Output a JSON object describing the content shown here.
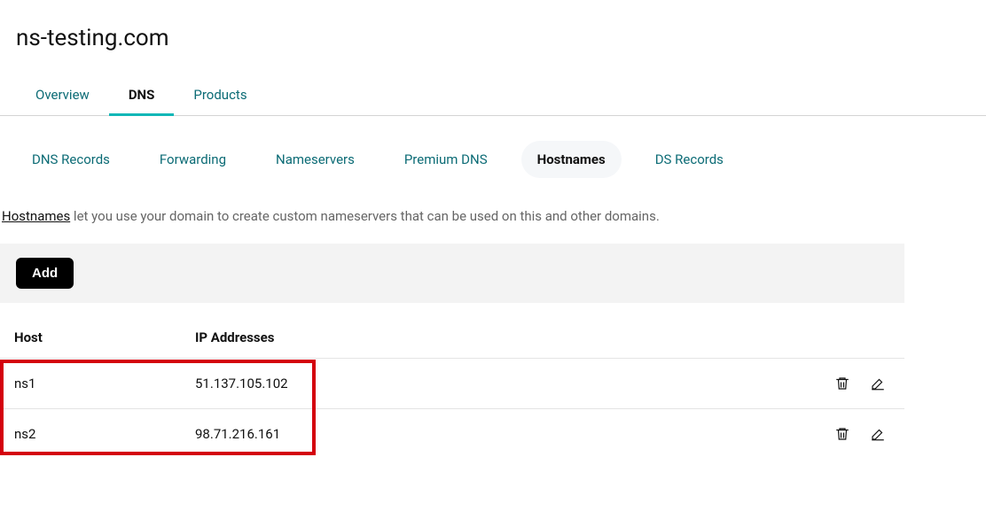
{
  "page_title": "ns-testing.com",
  "main_tabs": {
    "overview": "Overview",
    "dns": "DNS",
    "products": "Products",
    "active": "dns"
  },
  "sub_tabs": {
    "dns_records": "DNS Records",
    "forwarding": "Forwarding",
    "nameservers": "Nameservers",
    "premium_dns": "Premium DNS",
    "hostnames": "Hostnames",
    "ds_records": "DS Records",
    "active": "hostnames"
  },
  "description": {
    "link_text": "Hostnames",
    "rest_text": " let you use your domain to create custom nameservers that can be used on this and other domains."
  },
  "add_button_label": "Add",
  "table": {
    "headers": {
      "host": "Host",
      "ip": "IP Addresses"
    },
    "rows": [
      {
        "host": "ns1",
        "ip": "51.137.105.102"
      },
      {
        "host": "ns2",
        "ip": "98.71.216.161"
      }
    ]
  },
  "highlight_color": "#d4000d"
}
